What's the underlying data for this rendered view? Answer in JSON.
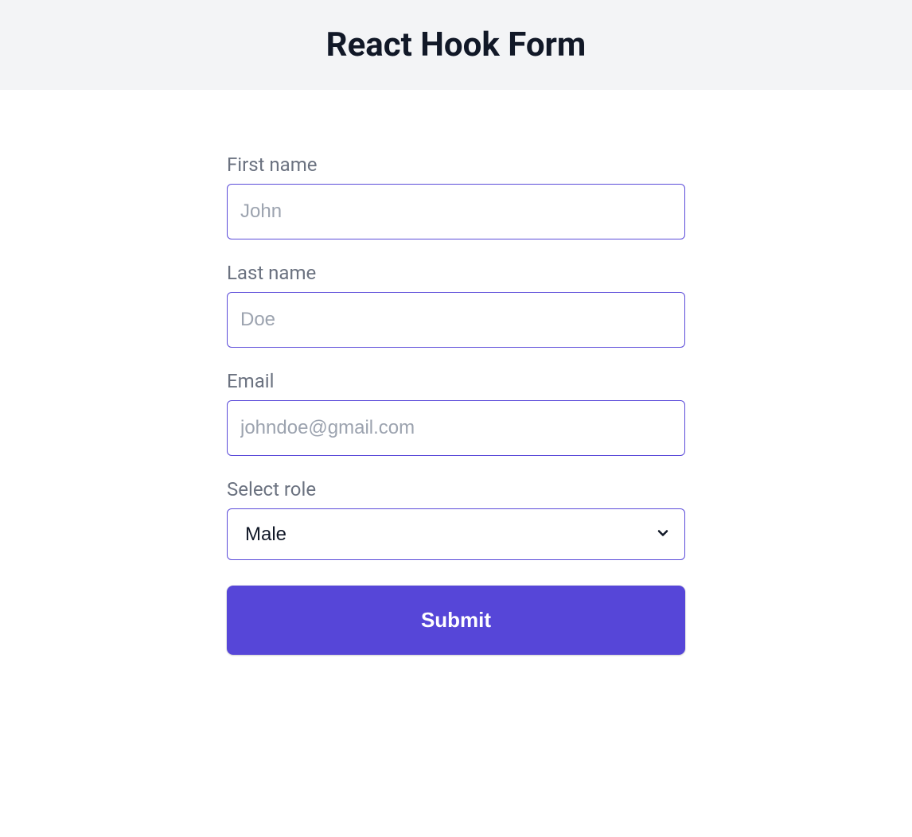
{
  "header": {
    "title": "React Hook Form"
  },
  "form": {
    "firstName": {
      "label": "First name",
      "placeholder": "John",
      "value": ""
    },
    "lastName": {
      "label": "Last name",
      "placeholder": "Doe",
      "value": ""
    },
    "email": {
      "label": "Email",
      "placeholder": "johndoe@gmail.com",
      "value": ""
    },
    "role": {
      "label": "Select role",
      "selected": "Male"
    },
    "submitLabel": "Submit"
  }
}
